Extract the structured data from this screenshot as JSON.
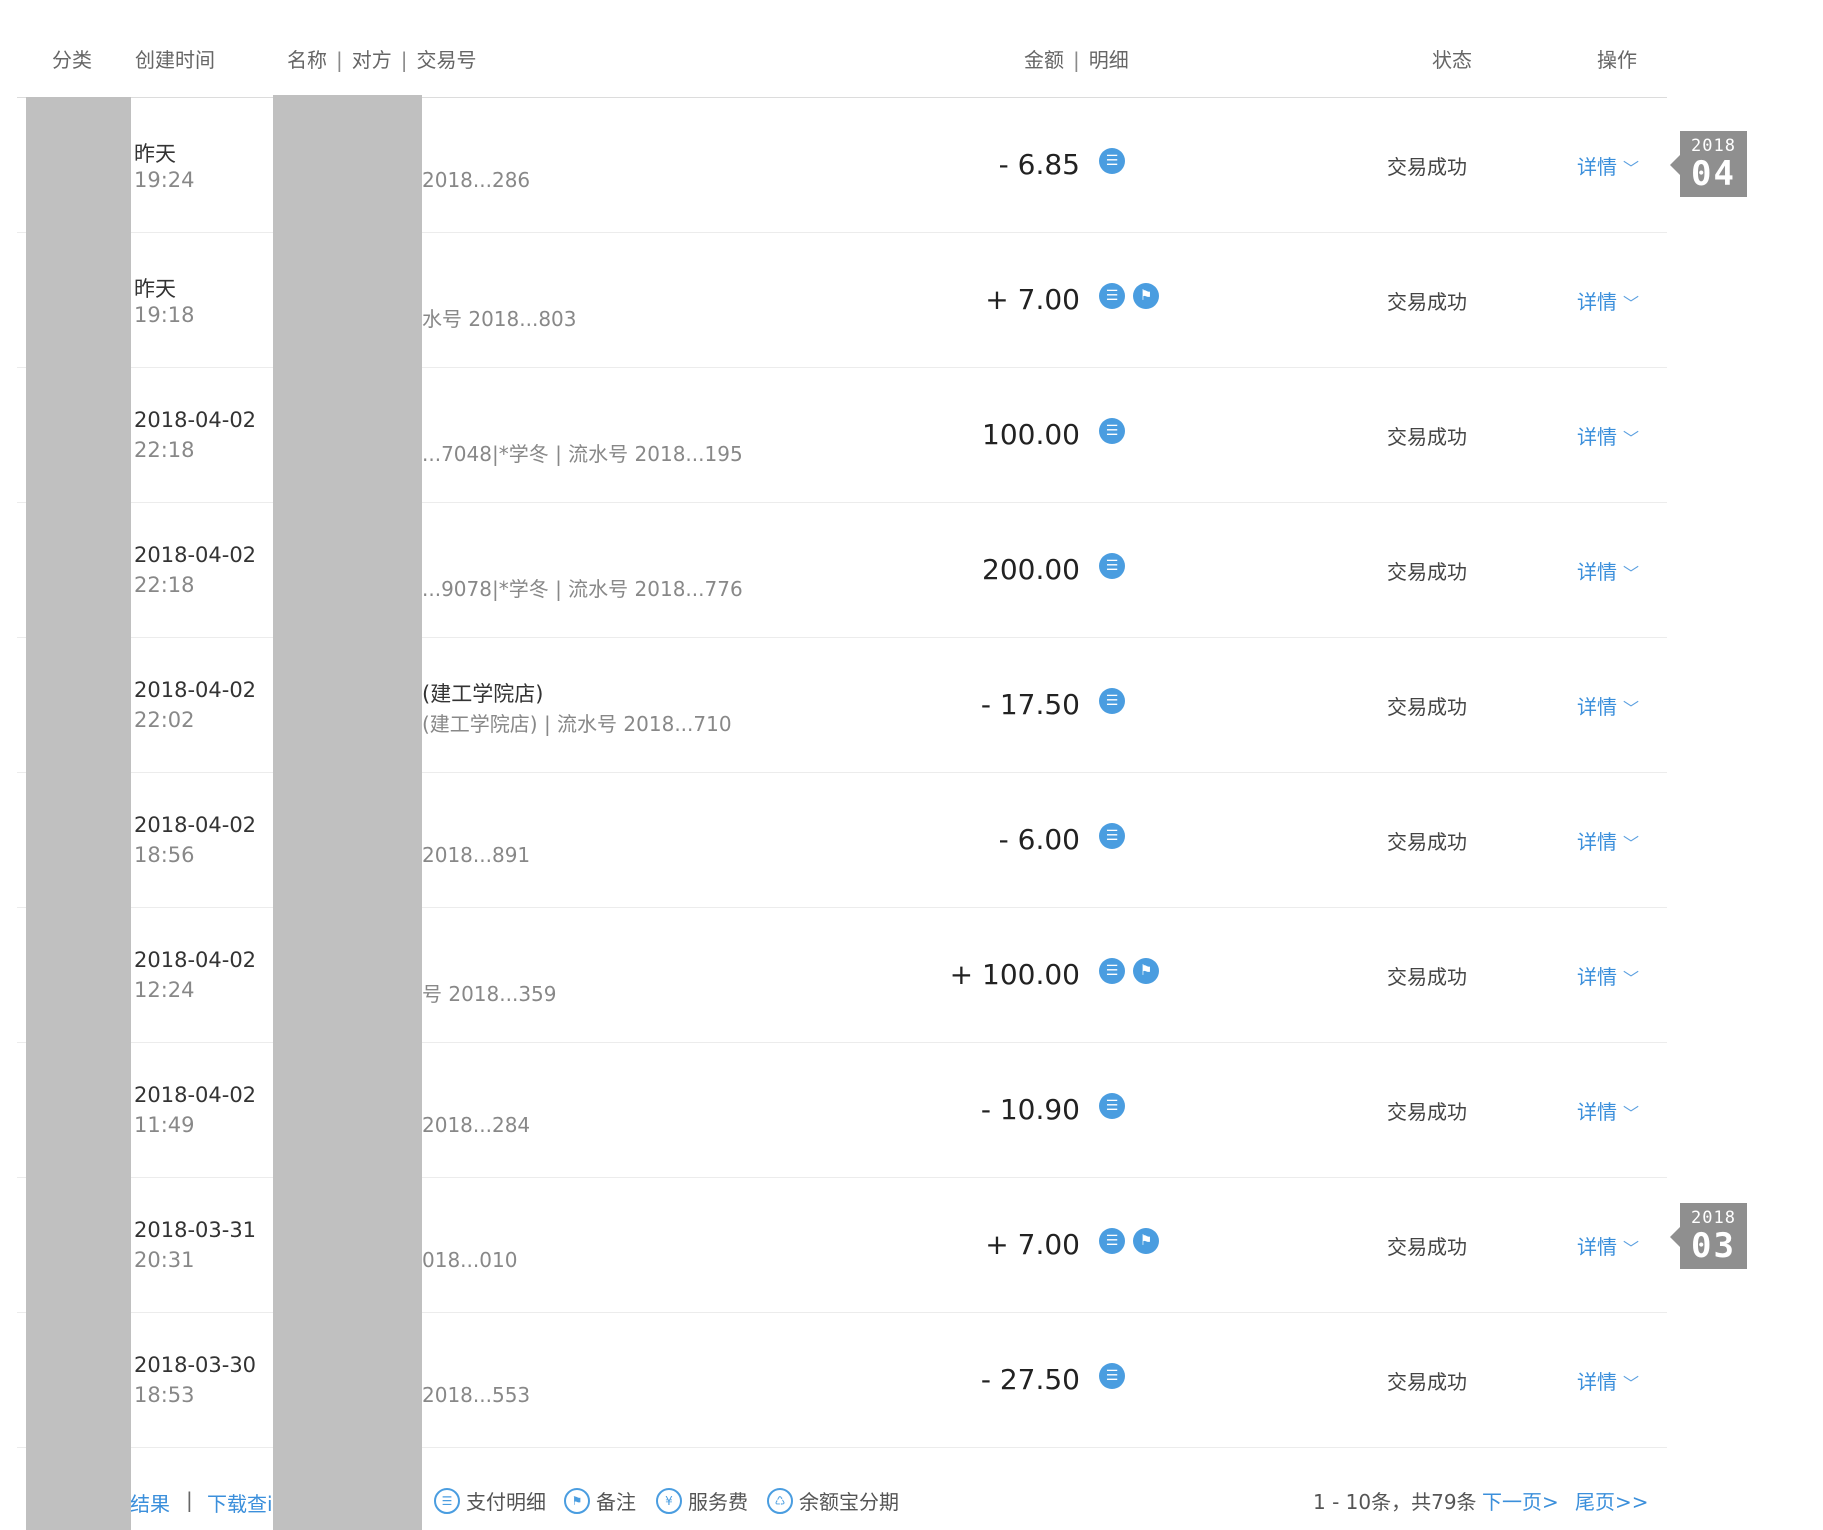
{
  "header": {
    "category": "分类",
    "created_time": "创建时间",
    "name": "名称",
    "counterparty": "对方",
    "trade_no": "交易号",
    "amount": "金额",
    "detail": "明细",
    "status": "状态",
    "action": "操作",
    "sep": "|"
  },
  "rows": [
    {
      "date": "昨天",
      "time": "19:24",
      "title": "",
      "sub": "2018...286",
      "amount": "- 6.85",
      "icons": [
        "list-icon"
      ],
      "status": "交易成功",
      "detail": "详情"
    },
    {
      "date": "昨天",
      "time": "19:18",
      "title": "",
      "sub": "水号 2018...803",
      "amount": "+ 7.00",
      "icons": [
        "list-icon",
        "flag-icon"
      ],
      "status": "交易成功",
      "detail": "详情"
    },
    {
      "date": "2018-04-02",
      "time": "22:18",
      "title": "",
      "sub": "...7048|*学冬 | 流水号 2018...195",
      "amount": "100.00",
      "icons": [
        "list-icon"
      ],
      "status": "交易成功",
      "detail": "详情"
    },
    {
      "date": "2018-04-02",
      "time": "22:18",
      "title": "",
      "sub": "...9078|*学冬 | 流水号 2018...776",
      "amount": "200.00",
      "icons": [
        "list-icon"
      ],
      "status": "交易成功",
      "detail": "详情"
    },
    {
      "date": "2018-04-02",
      "time": "22:02",
      "title": "(建工学院店)",
      "sub": "(建工学院店) | 流水号 2018...710",
      "amount": "- 17.50",
      "icons": [
        "list-icon"
      ],
      "status": "交易成功",
      "detail": "详情"
    },
    {
      "date": "2018-04-02",
      "time": "18:56",
      "title": "",
      "sub": "2018...891",
      "amount": "- 6.00",
      "icons": [
        "list-icon"
      ],
      "status": "交易成功",
      "detail": "详情"
    },
    {
      "date": "2018-04-02",
      "time": "12:24",
      "title": "",
      "sub": "号 2018...359",
      "amount": "+ 100.00",
      "icons": [
        "list-icon",
        "flag-icon"
      ],
      "status": "交易成功",
      "detail": "详情"
    },
    {
      "date": "2018-04-02",
      "time": "11:49",
      "title": "",
      "sub": "2018...284",
      "amount": "- 10.90",
      "icons": [
        "list-icon"
      ],
      "status": "交易成功",
      "detail": "详情"
    },
    {
      "date": "2018-03-31",
      "time": "20:31",
      "title": "",
      "sub": "018...010",
      "amount": "+ 7.00",
      "icons": [
        "list-icon",
        "flag-icon"
      ],
      "status": "交易成功",
      "detail": "详情"
    },
    {
      "date": "2018-03-30",
      "time": "18:53",
      "title": "",
      "sub": "2018...553",
      "amount": "- 27.50",
      "icons": [
        "list-icon"
      ],
      "status": "交易成功",
      "detail": "详情"
    }
  ],
  "month_badges": [
    {
      "year": "2018",
      "month": "04"
    },
    {
      "year": "2018",
      "month": "03"
    }
  ],
  "footer": {
    "left_link_1": "结果",
    "sep": "|",
    "left_link_2": "下载查i",
    "legend": [
      "支付明细",
      "备注",
      "服务费",
      "余额宝分期"
    ],
    "legend_icons": [
      "list-icon",
      "flag-icon",
      "yen-icon",
      "installment-icon"
    ],
    "page_info": "1 - 10条，共79条",
    "next": "下一页>",
    "last": "尾页>>"
  },
  "colors": {
    "link": "#3b8fdb",
    "icon": "#4a9de0",
    "redaction": "#c0c0c0",
    "badge": "#8f8f8f"
  }
}
